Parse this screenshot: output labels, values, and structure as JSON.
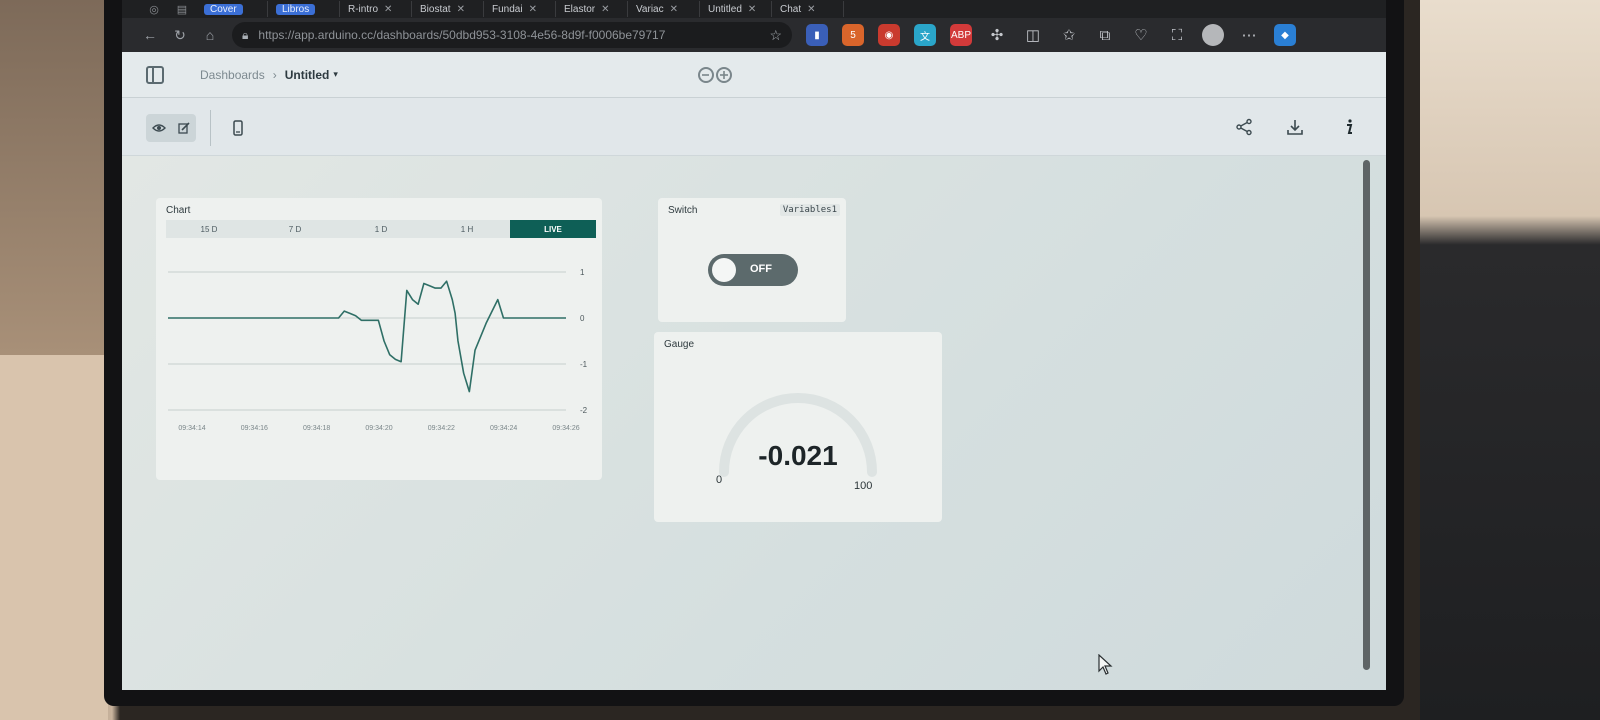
{
  "browser": {
    "tabs": [
      {
        "label": "Cover",
        "pill": true
      },
      {
        "label": "Libros",
        "pill": true
      },
      {
        "label": "R-intro",
        "pill": false
      },
      {
        "label": "Biostat",
        "pill": false
      },
      {
        "label": "Fundai",
        "pill": false
      },
      {
        "label": "Elastor",
        "pill": false
      },
      {
        "label": "Variac",
        "pill": false
      },
      {
        "label": "Untitled",
        "pill": false
      },
      {
        "label": "Chat",
        "pill": false
      }
    ],
    "url": "https://app.arduino.cc/dashboards/50dbd953-3108-4e56-8d9f-f0006be79717",
    "extensions": [
      {
        "name": "bookmark-ext-icon",
        "color": "#3a5fb8",
        "glyph": "▮"
      },
      {
        "name": "html5-ext-icon",
        "color": "#d9652b",
        "glyph": "5"
      },
      {
        "name": "red-ext-icon",
        "color": "#c93a2e",
        "glyph": "◉"
      },
      {
        "name": "translate-ext-icon",
        "color": "#2aa5c9",
        "glyph": "文"
      },
      {
        "name": "adblock-ext-icon",
        "color": "#d23a3a",
        "glyph": "ABP"
      }
    ]
  },
  "header": {
    "breadcrumb_root": "Dashboards",
    "title": "Untitled"
  },
  "widgets": {
    "chart": {
      "title": "Chart",
      "ranges": [
        "15 D",
        "7 D",
        "1 D",
        "1 H",
        "LIVE"
      ],
      "active_range": "LIVE"
    },
    "switch": {
      "title": "Switch",
      "variable": "Variables1",
      "state_label": "OFF"
    },
    "gauge": {
      "title": "Gauge",
      "value": "-0.021",
      "min": "0",
      "max": "100"
    }
  },
  "chart_data": {
    "type": "line",
    "yticks": [
      "1",
      "0",
      "-1",
      "-2"
    ],
    "ylim": [
      -2,
      1
    ],
    "xticks": [
      "09:34:14",
      "09:34:16",
      "09:34:18",
      "09:34:20",
      "09:34:22",
      "09:34:24",
      "09:34:26"
    ],
    "grid": true,
    "series": [
      {
        "color": "#2f6f66",
        "x": [
          0,
          0.2,
          0.4,
          0.6,
          0.8,
          1.0,
          1.2,
          1.4,
          1.6,
          1.8,
          2.0,
          2.2,
          2.4,
          2.6,
          2.8,
          3.0,
          3.1,
          3.2,
          3.3,
          3.4,
          3.5,
          3.6,
          3.7,
          3.8,
          3.9,
          4.0,
          4.1,
          4.2,
          4.3,
          4.4,
          4.5,
          4.6,
          4.7,
          4.8,
          4.9,
          5.0,
          5.05,
          5.1,
          5.2,
          5.3,
          5.4,
          5.5,
          5.6,
          5.7,
          5.8,
          5.9,
          6.0,
          6.1,
          6.2,
          6.3,
          6.4,
          6.5,
          6.6,
          6.7,
          6.8,
          6.9,
          7.0
        ],
        "y": [
          0,
          0,
          0,
          0,
          0,
          0,
          0,
          0,
          0,
          0,
          0,
          0,
          0,
          0,
          0,
          0,
          0.15,
          0.1,
          0.05,
          -0.05,
          -0.05,
          -0.05,
          -0.05,
          -0.5,
          -0.8,
          -0.9,
          -0.95,
          0.6,
          0.4,
          0.3,
          0.75,
          0.7,
          0.65,
          0.65,
          0.8,
          0.4,
          0.1,
          -0.5,
          -1.2,
          -1.6,
          -0.7,
          -0.4,
          -0.1,
          0.15,
          0.4,
          0,
          0,
          0,
          0,
          0,
          0,
          0,
          0,
          0,
          0,
          0,
          0
        ]
      }
    ]
  }
}
